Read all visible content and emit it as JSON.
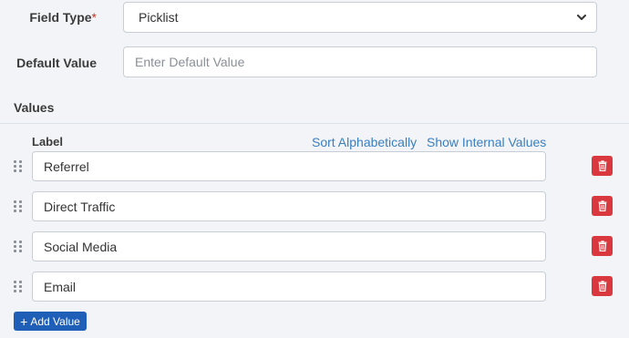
{
  "field_type": {
    "label": "Field Type",
    "required_mark": "*",
    "selected": "Picklist"
  },
  "default_value": {
    "label": "Default Value",
    "placeholder": "Enter Default Value"
  },
  "values_section": {
    "title": "Values",
    "column_label": "Label",
    "sort_link": "Sort Alphabetically",
    "internal_link": "Show Internal Values",
    "items": [
      {
        "label": "Referrel"
      },
      {
        "label": "Direct Traffic"
      },
      {
        "label": "Social Media"
      },
      {
        "label": "Email"
      }
    ],
    "add_button": "Add Value",
    "add_icon": "plus-icon"
  },
  "colors": {
    "delete": "#d9393e",
    "primary": "#1f5fb8",
    "link": "#3a7fbf",
    "required": "#c0392b"
  }
}
